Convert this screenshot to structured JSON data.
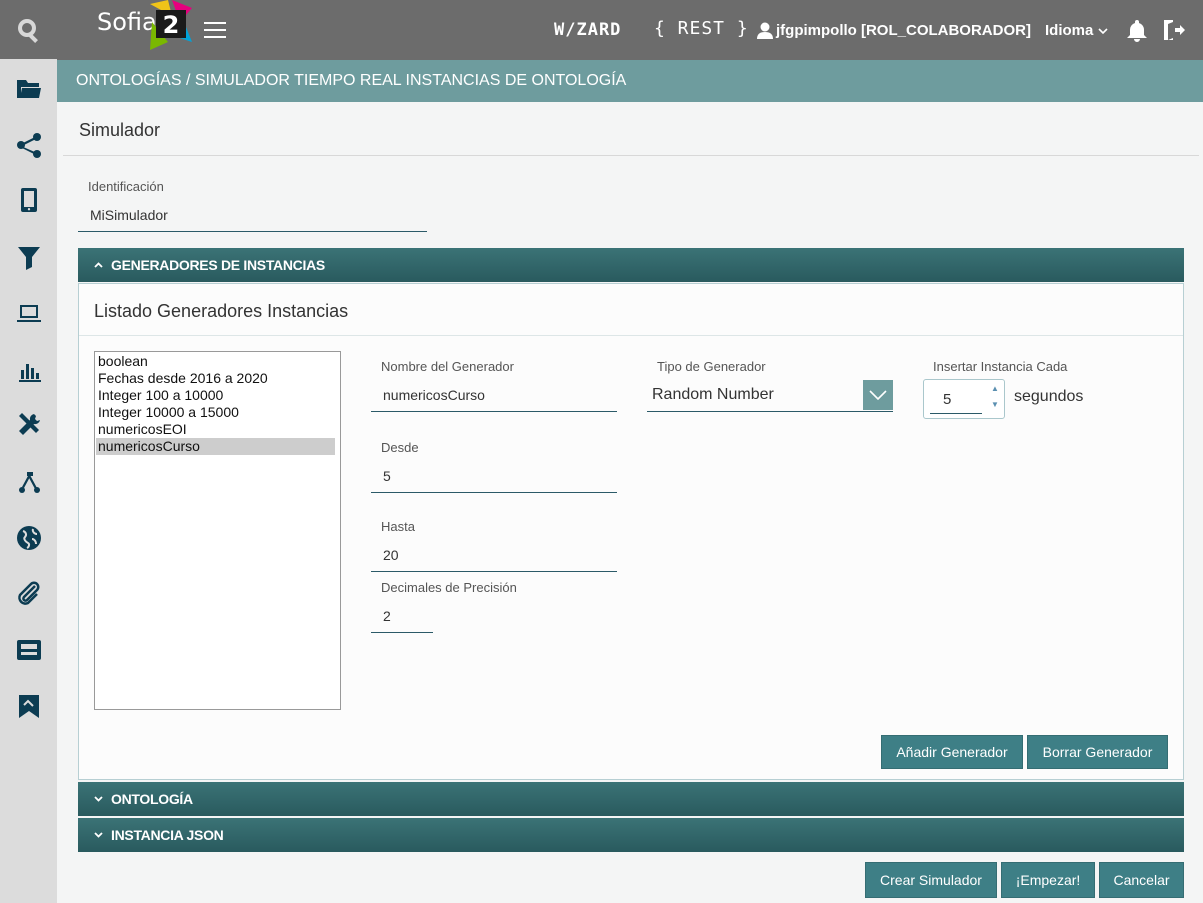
{
  "topbar": {
    "brand": "Sofia",
    "brand_number": "2",
    "wizard": "W/ZARD",
    "rest": "{ REST }",
    "user": "jfgpimpollo [ROL_COLABORADOR]",
    "language": "Idioma"
  },
  "sidebar": {
    "items": [
      "search-icon",
      "folder-icon",
      "share-icon",
      "mobile-icon",
      "filter-icon",
      "laptop-icon",
      "bar-chart-icon",
      "tools-icon",
      "flow-icon",
      "globe-icon",
      "paperclip-icon",
      "api-icon",
      "bookmark-icon"
    ]
  },
  "breadcrumb": "ONTOLOGÍAS / SIMULADOR TIEMPO REAL INSTANCIAS DE ONTOLOGÍA",
  "page_title": "Simulador",
  "identification": {
    "label": "Identificación",
    "value": "MiSimulador"
  },
  "accordions": {
    "generators": "GENERADORES DE INSTANCIAS",
    "ontology": "ONTOLOGÍA",
    "json": "INSTANCIA JSON"
  },
  "generators_panel": {
    "title": "Listado Generadores Instancias",
    "list": [
      "boolean",
      "Fechas desde 2016 a 2020",
      "Integer 100 a 10000",
      "Integer 10000 a 15000",
      "numericosEOI",
      "numericosCurso"
    ],
    "selected_index": 5,
    "name_label": "Nombre del Generador",
    "name_value": "numericosCurso",
    "type_label": "Tipo de Generador",
    "type_value": "Random Number",
    "insert_label": "Insertar Instancia Cada",
    "insert_value": "5",
    "insert_unit": "segundos",
    "from_label": "Desde",
    "from_value": "5",
    "to_label": "Hasta",
    "to_value": "20",
    "decimals_label": "Decimales de Precisión",
    "decimals_value": "2",
    "add_button": "Añadir Generador",
    "delete_button": "Borrar Generador"
  },
  "footer": {
    "create": "Crear Simulador",
    "start": "¡Empezar!",
    "cancel": "Cancelar"
  },
  "colors": {
    "topbar": "#6c6c6c",
    "breadcrumb": "#6e9c9e",
    "accent": "#3e7f86",
    "icon": "#0c3c52"
  }
}
